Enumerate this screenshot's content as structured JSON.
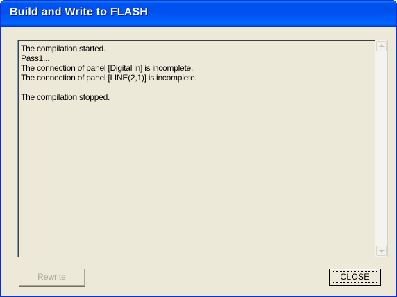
{
  "window": {
    "title": "Build and Write to FLASH"
  },
  "log": {
    "lines": [
      "The compilation started.",
      "Pass1...",
      "The connection of panel [Digital in] is incomplete.",
      "The connection of panel [LINE(2,1)] is incomplete.",
      "",
      "The compilation stopped."
    ]
  },
  "buttons": {
    "rewrite_label": "Rewrite",
    "rewrite_enabled": false,
    "close_label": "CLOSE"
  },
  "icons": {
    "scroll_up": "scroll-up-arrow-icon",
    "scroll_down": "scroll-down-arrow-icon"
  }
}
